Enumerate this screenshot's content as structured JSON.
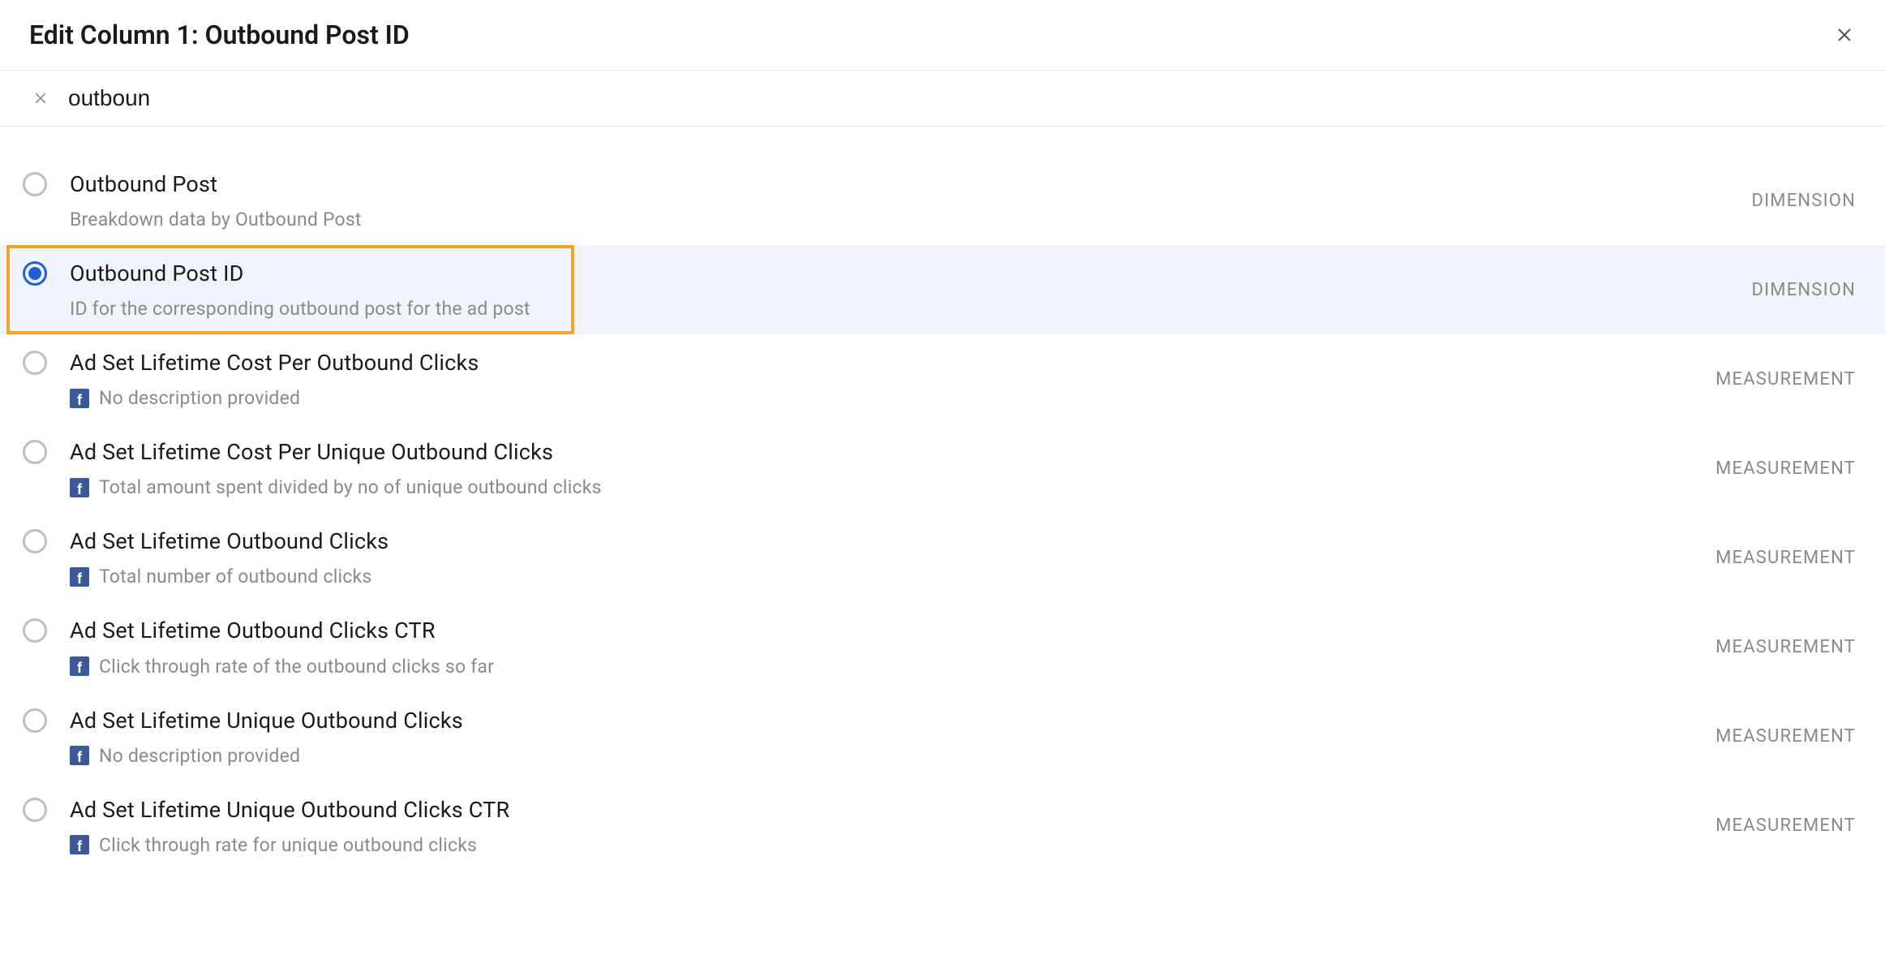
{
  "header": {
    "title": "Edit Column 1: Outbound Post ID"
  },
  "search": {
    "value": "outboun"
  },
  "badges": {
    "dimension": "DIMENSION",
    "measurement": "MEASUREMENT"
  },
  "options": [
    {
      "label": "Outbound Post",
      "desc": "Breakdown data by Outbound Post",
      "type": "dimension",
      "selected": false,
      "has_fb_icon": false
    },
    {
      "label": "Outbound Post ID",
      "desc": "ID for the corresponding outbound post for the ad post",
      "type": "dimension",
      "selected": true,
      "has_fb_icon": false
    },
    {
      "label": "Ad Set Lifetime Cost Per Outbound Clicks",
      "desc": "No description provided",
      "type": "measurement",
      "selected": false,
      "has_fb_icon": true
    },
    {
      "label": "Ad Set Lifetime Cost Per Unique Outbound Clicks",
      "desc": "Total amount spent divided by no of unique outbound clicks",
      "type": "measurement",
      "selected": false,
      "has_fb_icon": true
    },
    {
      "label": "Ad Set Lifetime Outbound Clicks",
      "desc": "Total number of outbound clicks",
      "type": "measurement",
      "selected": false,
      "has_fb_icon": true
    },
    {
      "label": "Ad Set Lifetime Outbound Clicks CTR",
      "desc": "Click through rate of the outbound clicks so far",
      "type": "measurement",
      "selected": false,
      "has_fb_icon": true
    },
    {
      "label": "Ad Set Lifetime Unique Outbound Clicks",
      "desc": "No description provided",
      "type": "measurement",
      "selected": false,
      "has_fb_icon": true
    },
    {
      "label": "Ad Set Lifetime Unique Outbound Clicks CTR",
      "desc": "Click through rate for unique outbound clicks",
      "type": "measurement",
      "selected": false,
      "has_fb_icon": true
    }
  ]
}
